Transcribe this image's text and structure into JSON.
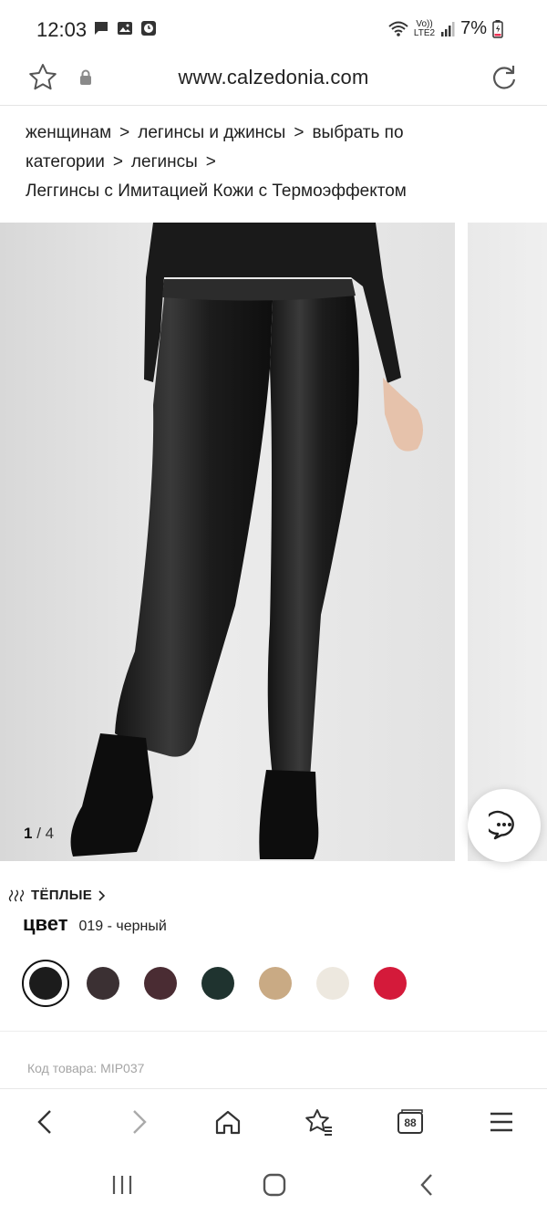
{
  "status_bar": {
    "time": "12:03",
    "network_top": "Vo))",
    "network_bottom": "LTE2",
    "battery": "7%"
  },
  "url_bar": {
    "url": "www.calzedonia.com"
  },
  "breadcrumb": {
    "items": [
      "женщинам",
      "легинсы и джинсы",
      "выбрать по категории",
      "легинсы"
    ],
    "separator": ">",
    "current": "Леггинсы с Имитацией Кожи с Термоэффектом"
  },
  "gallery": {
    "current_index": "1",
    "total": "/ 4"
  },
  "product": {
    "warm_label": "ТЁПЛЫЕ",
    "color_title": "цвет",
    "color_value": "019 - черный",
    "swatches": [
      {
        "color": "#1c1c1c",
        "selected": true
      },
      {
        "color": "#3b3033"
      },
      {
        "color": "#4a2c33"
      },
      {
        "color": "#1f332f"
      },
      {
        "color": "#c9aa84"
      },
      {
        "color": "#ede8df"
      },
      {
        "color": "#d41a3a"
      }
    ],
    "sku": "Код товара: MIP037"
  },
  "toolbar": {
    "tabs_count": "88"
  },
  "colors": {
    "accent_dark": "#111111",
    "muted_text": "#a5a5a5"
  }
}
